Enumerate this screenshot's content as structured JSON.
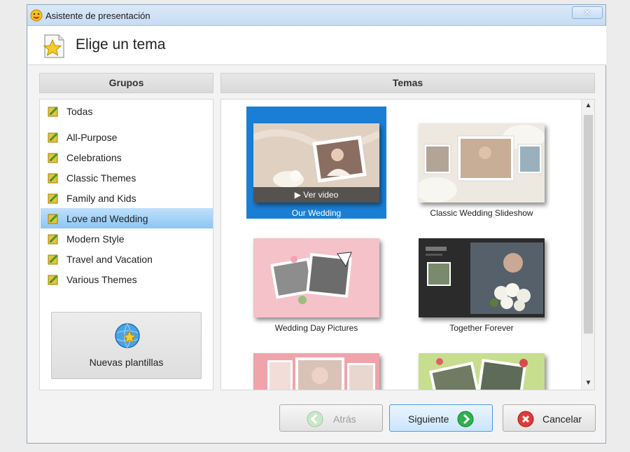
{
  "window": {
    "title": "Asistente de presentación",
    "close_label": "✕"
  },
  "header": {
    "title": "Elige un tema"
  },
  "groups": {
    "heading": "Grupos",
    "selected_index": 5,
    "items": [
      {
        "label": "Todas"
      },
      {
        "label": "All-Purpose"
      },
      {
        "label": "Celebrations"
      },
      {
        "label": "Classic Themes"
      },
      {
        "label": "Family and Kids"
      },
      {
        "label": "Love and Wedding"
      },
      {
        "label": "Modern Style"
      },
      {
        "label": "Travel and Vacation"
      },
      {
        "label": "Various Themes"
      }
    ],
    "new_templates_label": "Nuevas plantillas"
  },
  "themes": {
    "heading": "Temas",
    "play_label": "▶  Ver video",
    "items": [
      {
        "label": "Our Wedding",
        "selected": true
      },
      {
        "label": "Classic Wedding Slideshow",
        "selected": false
      },
      {
        "label": "Wedding Day Pictures",
        "selected": false
      },
      {
        "label": "Together Forever",
        "selected": false
      },
      {
        "label": "",
        "selected": false
      },
      {
        "label": "",
        "selected": false
      }
    ]
  },
  "buttons": {
    "back": "Atrás",
    "next": "Siguiente",
    "cancel": "Cancelar"
  },
  "icons": {
    "window": "smiley-icon",
    "header": "star-document-icon",
    "group": "pencil-note-icon",
    "new_templates": "globe-star-icon",
    "back": "arrow-left-circle-icon",
    "next": "arrow-right-circle-icon",
    "cancel": "x-circle-icon"
  },
  "colors": {
    "selection": "#1a7fd4",
    "list_selection": "#9fd0f7",
    "next_accent": "#4c9be0"
  }
}
